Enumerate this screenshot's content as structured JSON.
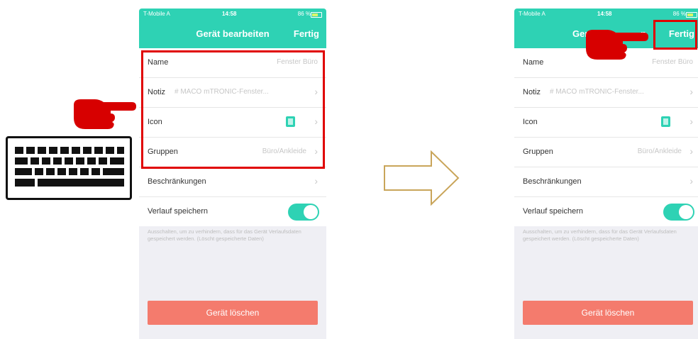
{
  "status_bar": {
    "carrier": "T-Mobile A",
    "time": "14:58",
    "battery": "86 %"
  },
  "left_screen": {
    "title": "Gerät bearbeiten",
    "done_label": "Fertig",
    "rows": [
      {
        "label": "Name",
        "value": "Fenster Büro"
      },
      {
        "label": "Notiz",
        "value": "# MACO mTRONIC-Fenster..."
      },
      {
        "label": "Icon",
        "value": ""
      },
      {
        "label": "Gruppen",
        "value": "Büro/Ankleide"
      },
      {
        "label": "Beschränkungen",
        "value": ""
      },
      {
        "label": "Verlauf speichern",
        "value": ""
      }
    ],
    "hint": "Ausschalten, um zu verhindern, dass für das Gerät Verlaufsdaten gespeichert werden. (Löscht gespeicherte Daten)",
    "delete_label": "Gerät löschen"
  },
  "right_screen": {
    "title_left": "Gerä",
    "title_right": "n",
    "done_label": "Fertig",
    "rows": [
      {
        "label": "Name",
        "value": "Fenster Büro"
      },
      {
        "label": "Notiz",
        "value": "# MACO mTRONIC-Fenster..."
      },
      {
        "label": "Icon",
        "value": ""
      },
      {
        "label": "Gruppen",
        "value": "Büro/Ankleide"
      },
      {
        "label": "Beschränkungen",
        "value": ""
      },
      {
        "label": "Verlauf speichern",
        "value": ""
      }
    ],
    "hint": "Ausschalten, um zu verhindern, dass für das Gerät Verlaufsdaten gespeichert werden. (Löscht gespeicherte Daten)",
    "delete_label": "Gerät löschen"
  },
  "toggle_on": true,
  "colors": {
    "header": "#2ed2b4",
    "delete_button": "#f47b6d",
    "highlight": "#e00000",
    "arrow": "#c9a55a"
  },
  "icons": [
    "keyboard-icon",
    "pointing-hand-icon",
    "arrow-right-icon",
    "chevron-right-icon",
    "device-icon"
  ]
}
